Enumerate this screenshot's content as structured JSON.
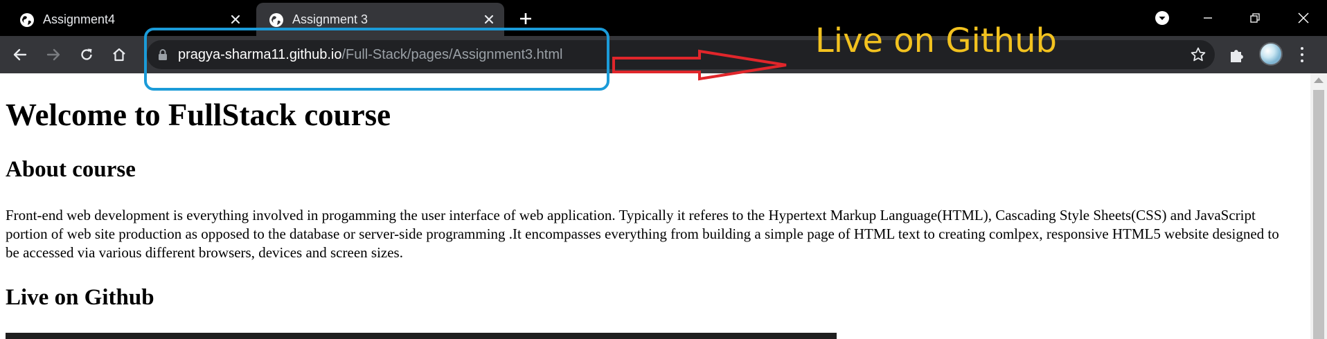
{
  "browser": {
    "tabs": [
      {
        "title": "Assignment4",
        "active": false
      },
      {
        "title": "Assignment 3",
        "active": true
      }
    ],
    "icons": {
      "favicon": "globe-icon",
      "tab_close": "close-icon",
      "new_tab": "plus-icon",
      "tab_search": "chevron-down-circle-icon",
      "minimize": "minimize-icon",
      "restore": "restore-icon",
      "close_window": "close-icon",
      "back": "back-arrow-icon",
      "forward": "forward-arrow-icon",
      "reload": "reload-icon",
      "home": "home-icon",
      "lock": "lock-icon",
      "bookmark": "star-icon",
      "extensions": "puzzle-icon",
      "profile": "avatar",
      "menu": "kebab-menu-icon"
    },
    "address_bar": {
      "host": "pragya-sharma11.github.io",
      "path": "/Full-Stack/pages/Assignment3.html"
    }
  },
  "annotation": {
    "text": "Live on Github",
    "box_color": "#1b9bd8",
    "arrow_color": "#e0262b",
    "text_color": "#f2c21f"
  },
  "page": {
    "heading": "Welcome to FullStack course",
    "about_heading": "About course",
    "about_text": "Front-end web development is everything involved in progamming the user interface of web application. Typically it referes to the Hypertext Markup Language(HTML), Cascading Style Sheets(CSS) and JavaScript portion of web site production as opposed to the database or server-side programming .It encompasses everything from building a simple page of HTML text to creating comlpex, responsive HTML5 website designed to be accessed via various different browsers, devices and screen sizes.",
    "live_heading": "Live on Github"
  }
}
